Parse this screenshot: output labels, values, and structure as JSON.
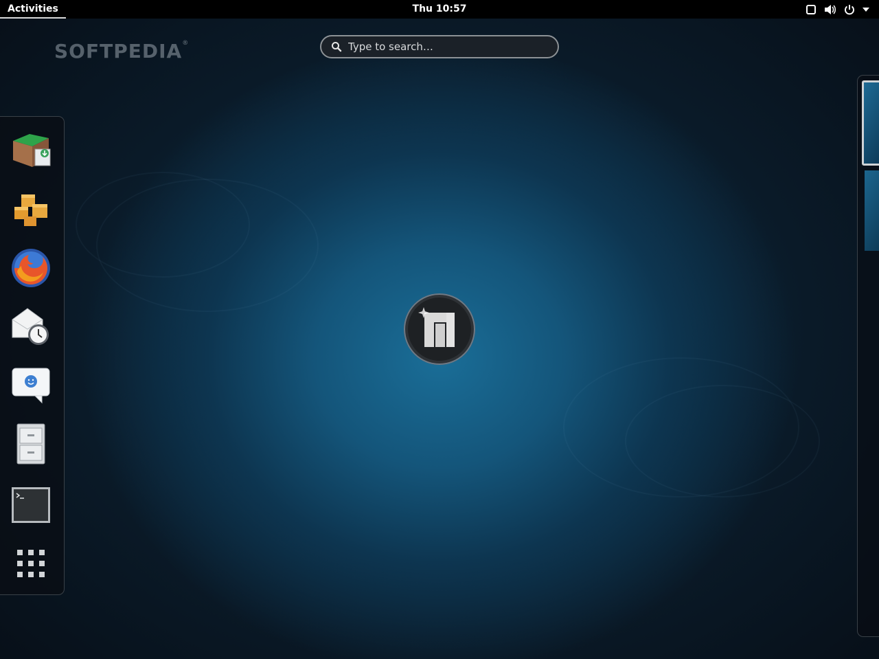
{
  "topbar": {
    "activities_label": "Activities",
    "clock": "Thu 10:57",
    "status_icons": [
      "window-icon",
      "volume-icon",
      "power-icon",
      "chevron-down-icon"
    ]
  },
  "watermark": {
    "text": "SOFTPEDIA",
    "mark": "®"
  },
  "search": {
    "placeholder": "Type to search…",
    "value": ""
  },
  "dash": {
    "items": [
      {
        "name": "software-installer-icon"
      },
      {
        "name": "package-manager-icon"
      },
      {
        "name": "firefox-icon"
      },
      {
        "name": "mail-client-icon"
      },
      {
        "name": "chat-icon"
      },
      {
        "name": "file-cabinet-icon"
      },
      {
        "name": "terminal-icon"
      },
      {
        "name": "show-applications-icon"
      }
    ]
  },
  "workspaces": {
    "count": 2,
    "active": 1
  },
  "colors": {
    "topbar": "#000000",
    "background_center": "#1a6e98",
    "background_edge": "#070f18",
    "search_border": "#8d9296"
  }
}
